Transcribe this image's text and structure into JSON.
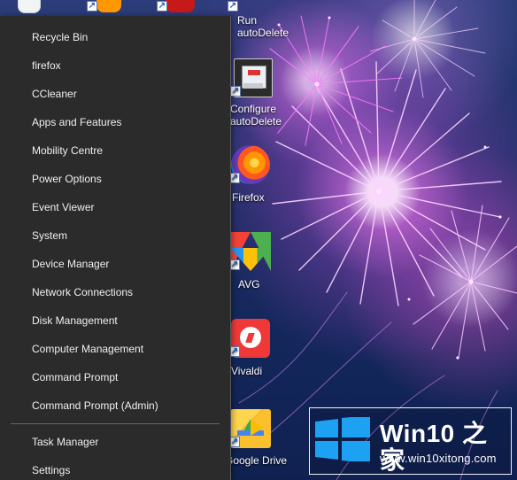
{
  "desktop": {
    "icons": [
      {
        "label": "Run\nautoDelete"
      },
      {
        "label": "Configure\nautoDelete"
      },
      {
        "label": "Firefox"
      },
      {
        "label": "AVG"
      },
      {
        "label": "Vivaldi"
      },
      {
        "label": "Google Drive"
      }
    ]
  },
  "context_menu": {
    "items": [
      "Recycle Bin",
      "firefox",
      "CCleaner",
      "Apps and Features",
      "Mobility Centre",
      "Power Options",
      "Event Viewer",
      "System",
      "Device Manager",
      "Network Connections",
      "Disk Management",
      "Computer Management",
      "Command Prompt",
      "Command Prompt (Admin)",
      "Task Manager",
      "Settings"
    ]
  },
  "watermark": {
    "brand": "Win10 之家",
    "url": "www.win10xitong.com"
  },
  "colors": {
    "menu_bg": "#2b2b2b",
    "menu_text": "#f0f0f0",
    "win_blue": "#1da1f2",
    "firefox_orange": "#ff7139",
    "avg_green": "#34a853",
    "vivaldi_red": "#ef3939"
  },
  "icons": {
    "recycle": "recycle-bin-icon",
    "firefox": "firefox-icon",
    "avg": "avg-icon",
    "vivaldi": "vivaldi-icon",
    "drive": "google-drive-icon",
    "config": "configure-icon"
  }
}
